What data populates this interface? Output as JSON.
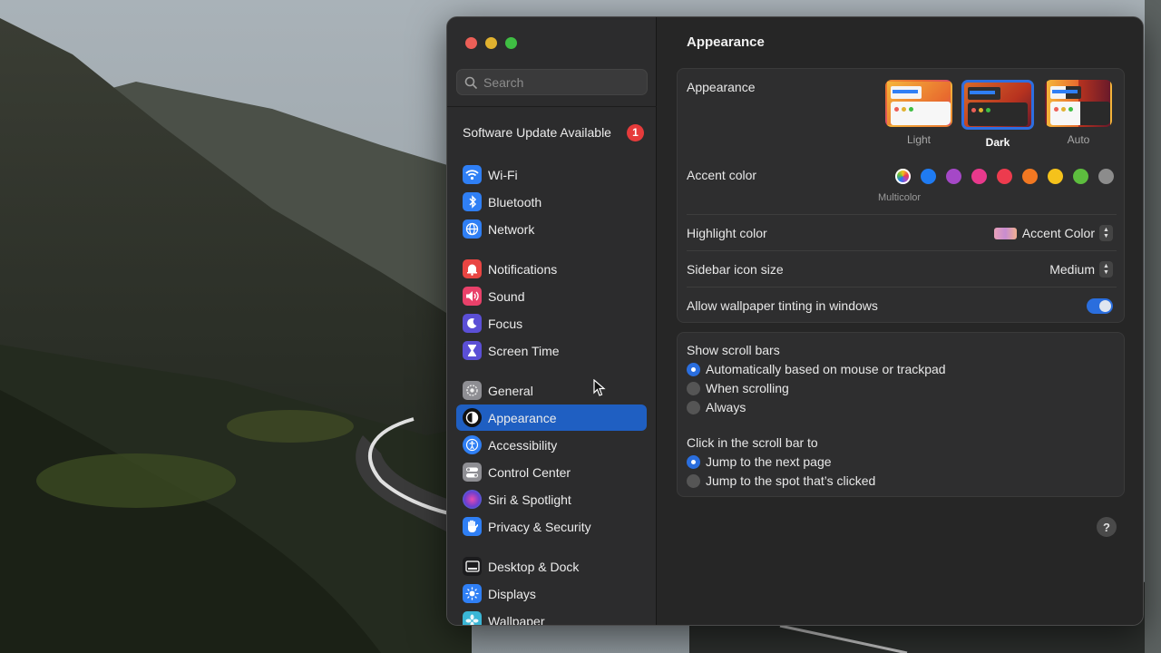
{
  "sidebar": {
    "search_placeholder": "Search",
    "update_label": "Software Update Available",
    "update_badge": "1",
    "items": [
      {
        "id": "wifi",
        "label": "Wi-Fi",
        "color": "#2f7ff5"
      },
      {
        "id": "bluetooth",
        "label": "Bluetooth",
        "color": "#2f7ff5"
      },
      {
        "id": "network",
        "label": "Network",
        "color": "#2f7ff5"
      },
      {
        "id": "notifications",
        "label": "Notifications",
        "color": "#e94542"
      },
      {
        "id": "sound",
        "label": "Sound",
        "color": "#e9416a"
      },
      {
        "id": "focus",
        "label": "Focus",
        "color": "#5b4fd6"
      },
      {
        "id": "screen-time",
        "label": "Screen Time",
        "color": "#5b4fd6"
      },
      {
        "id": "general",
        "label": "General",
        "color": "#8e8e93"
      },
      {
        "id": "appearance",
        "label": "Appearance",
        "color": "#111111"
      },
      {
        "id": "accessibility",
        "label": "Accessibility",
        "color": "#2f7ff5"
      },
      {
        "id": "control-center",
        "label": "Control Center",
        "color": "#8e8e93"
      },
      {
        "id": "siri-spotlight",
        "label": "Siri & Spotlight",
        "color": "#6a3fd0"
      },
      {
        "id": "privacy-security",
        "label": "Privacy & Security",
        "color": "#2f7ff5"
      },
      {
        "id": "desktop-dock",
        "label": "Desktop & Dock",
        "color": "#1c1c1e"
      },
      {
        "id": "displays",
        "label": "Displays",
        "color": "#2f7ff5"
      },
      {
        "id": "wallpaper",
        "label": "Wallpaper",
        "color": "#3ab6d6"
      }
    ],
    "selected": "Appearance"
  },
  "main": {
    "title": "Appearance",
    "appearance_label": "Appearance",
    "themes": [
      {
        "label": "Light",
        "selected": false
      },
      {
        "label": "Dark",
        "selected": true
      },
      {
        "label": "Auto",
        "selected": false
      }
    ],
    "accent_label": "Accent color",
    "accent_caption": "Multicolor",
    "accent_colors": [
      "multicolor",
      "#1f7bf2",
      "#a548c7",
      "#e8398c",
      "#ed3b4e",
      "#f27822",
      "#f5c21b",
      "#5dbd3e",
      "#8c8c8c"
    ],
    "highlight_label": "Highlight color",
    "highlight_value": "Accent Color",
    "sidebar_icon_label": "Sidebar icon size",
    "sidebar_icon_value": "Medium",
    "tinting_label": "Allow wallpaper tinting in windows",
    "tinting_on": true,
    "scroll_label": "Show scroll bars",
    "scroll_options": [
      {
        "label": "Automatically based on mouse or trackpad",
        "selected": true
      },
      {
        "label": "When scrolling",
        "selected": false
      },
      {
        "label": "Always",
        "selected": false
      }
    ],
    "click_label": "Click in the scroll bar to",
    "click_options": [
      {
        "label": "Jump to the next page",
        "selected": true
      },
      {
        "label": "Jump to the spot that’s clicked",
        "selected": false
      }
    ],
    "help_label": "?"
  }
}
